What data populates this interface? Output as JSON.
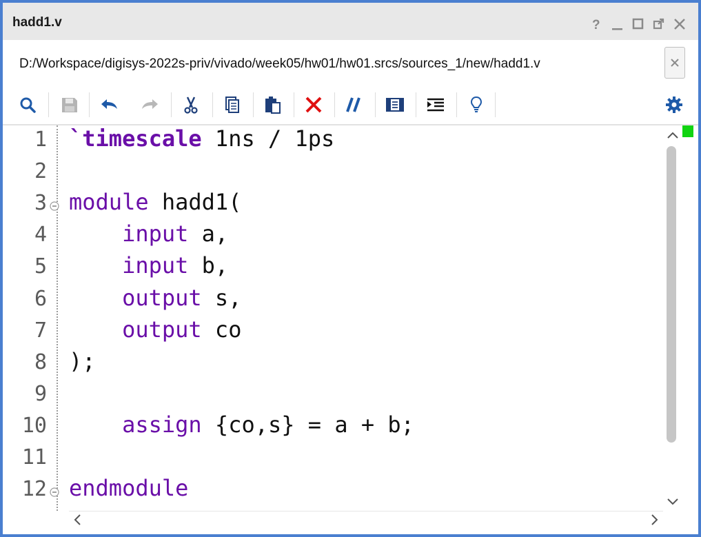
{
  "window": {
    "title": "hadd1.v",
    "controls": [
      "help-icon",
      "minimize-icon",
      "maximize-icon",
      "float-icon",
      "close-icon"
    ]
  },
  "file": {
    "path": "D:/Workspace/digisys-2022s-priv/vivado/week05/hw01/hw01.srcs/sources_1/new/hadd1.v",
    "close_label": "×"
  },
  "toolbar": {
    "icons": [
      "search-icon",
      "save-icon",
      "undo-icon",
      "redo-icon",
      "cut-icon",
      "copy-icon",
      "paste-icon",
      "delete-icon",
      "comment-icon",
      "insert-template-icon",
      "indent-icon",
      "lightbulb-icon"
    ],
    "settings_icon": "gear-icon"
  },
  "editor": {
    "lines": [
      {
        "num": "1",
        "parts": [
          {
            "t": "`timescale",
            "k": "kwb"
          },
          {
            "t": " 1ns / 1ps",
            "k": ""
          }
        ]
      },
      {
        "num": "2",
        "parts": []
      },
      {
        "num": "3",
        "parts": [
          {
            "t": "module",
            "k": "kw"
          },
          {
            "t": " hadd1(",
            "k": ""
          }
        ]
      },
      {
        "num": "4",
        "parts": [
          {
            "t": "    ",
            "k": ""
          },
          {
            "t": "input",
            "k": "kw"
          },
          {
            "t": " a,",
            "k": ""
          }
        ]
      },
      {
        "num": "5",
        "parts": [
          {
            "t": "    ",
            "k": ""
          },
          {
            "t": "input",
            "k": "kw"
          },
          {
            "t": " b,",
            "k": ""
          }
        ]
      },
      {
        "num": "6",
        "parts": [
          {
            "t": "    ",
            "k": ""
          },
          {
            "t": "output",
            "k": "kw"
          },
          {
            "t": " s,",
            "k": ""
          }
        ]
      },
      {
        "num": "7",
        "parts": [
          {
            "t": "    ",
            "k": ""
          },
          {
            "t": "output",
            "k": "kw"
          },
          {
            "t": " co",
            "k": ""
          }
        ]
      },
      {
        "num": "8",
        "parts": [
          {
            "t": ");",
            "k": ""
          }
        ]
      },
      {
        "num": "9",
        "parts": []
      },
      {
        "num": "10",
        "parts": [
          {
            "t": "    ",
            "k": ""
          },
          {
            "t": "assign",
            "k": "kw"
          },
          {
            "t": " {co,s} = a + b;",
            "k": ""
          }
        ]
      },
      {
        "num": "11",
        "parts": []
      },
      {
        "num": "12",
        "parts": [
          {
            "t": "endmodule",
            "k": "kw"
          }
        ]
      }
    ],
    "fold_lines": [
      "3",
      "12"
    ]
  },
  "colors": {
    "window_border": "#4a7fd0",
    "keyword": "#6a0fa8",
    "icon_blue": "#1e5aa8",
    "delete_red": "#e01010",
    "marker_green": "#11d411"
  }
}
